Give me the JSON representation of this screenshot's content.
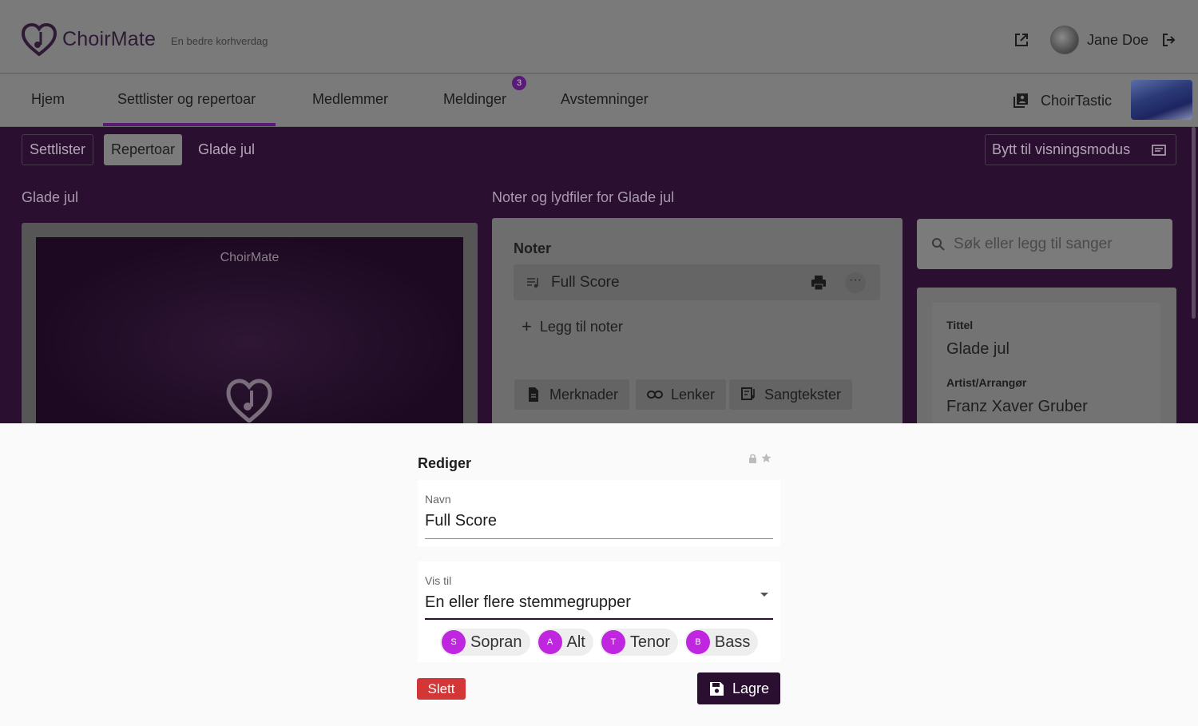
{
  "header": {
    "app_name": "ChoirMate",
    "tagline": "En bedre korhverdag",
    "user_name": "Jane Doe"
  },
  "nav": {
    "items": [
      "Hjem",
      "Settlister og repertoar",
      "Medlemmer",
      "Meldinger",
      "Avstemninger"
    ],
    "active_index": 1,
    "messages_badge": "3",
    "choir_name": "ChoirTastic"
  },
  "subnav": {
    "items": [
      "Settlister",
      "Repertoar",
      "Glade jul"
    ],
    "view_mode_label": "Bytt til visningsmodus"
  },
  "left_panel": {
    "title": "Glade jul",
    "poster_title": "ChoirMate"
  },
  "mid_panel": {
    "title": "Noter og lydfiler for Glade jul",
    "section_title": "Noter",
    "score_name": "Full Score",
    "add_note_label": "Legg til noter",
    "buttons": [
      "Merknader",
      "Lenker",
      "Sangtekster"
    ]
  },
  "right_panel": {
    "search_placeholder": "Søk eller legg til sanger",
    "title_label": "Tittel",
    "title_value": "Glade jul",
    "artist_label": "Artist/Arrangør",
    "artist_value": "Franz Xaver Gruber"
  },
  "edit_sheet": {
    "title": "Rediger",
    "name_label": "Navn",
    "name_value": "Full Score",
    "visibility_label": "Vis til",
    "visibility_value": "En eller flere stemmegrupper",
    "voice_groups": [
      {
        "initial": "S",
        "name": "Sopran"
      },
      {
        "initial": "A",
        "name": "Alt"
      },
      {
        "initial": "T",
        "name": "Tenor"
      },
      {
        "initial": "B",
        "name": "Bass"
      }
    ],
    "delete_label": "Slett",
    "save_label": "Lagre"
  },
  "colors": {
    "brand_dark": "#2a0f31",
    "chip_avatar": "#c026e0",
    "danger": "#d33636"
  }
}
